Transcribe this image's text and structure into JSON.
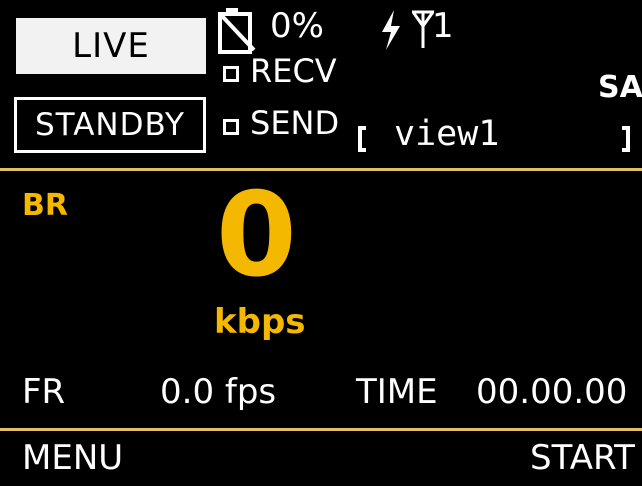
{
  "mode": {
    "live_label": "LIVE",
    "standby_label": "STANDBY"
  },
  "status": {
    "battery_percent": "0%",
    "antenna_count": "1",
    "battery_icon": "battery-crossed-icon",
    "charge_icon": "lightning-bolt-icon",
    "antenna_icon": "antenna-icon"
  },
  "streams": {
    "recv_label": "RECV",
    "send_label": "SEND",
    "view_label": "view1",
    "side_label": "SA"
  },
  "bitrate": {
    "label": "BR",
    "value": "0",
    "unit": "kbps"
  },
  "stats": {
    "fr_label": "FR",
    "fr_value": "0.0 fps",
    "time_label": "TIME",
    "time_value": "00.00.00"
  },
  "footer": {
    "menu_label": "MENU",
    "start_label": "START"
  },
  "colors": {
    "accent": "#f5b800",
    "divider": "#e0c060",
    "background": "#000000",
    "text": "#ffffff"
  }
}
